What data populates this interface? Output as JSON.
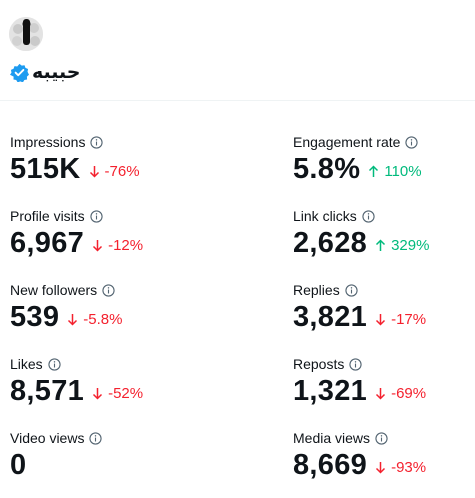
{
  "profile": {
    "name": "حبيبه",
    "verified": true,
    "accent_color": "#1d9bf0"
  },
  "colors": {
    "down": "#f4212e",
    "up": "#00ba7c"
  },
  "metrics": [
    {
      "label": "Impressions",
      "value": "515K",
      "change": "-76%",
      "direction": "down"
    },
    {
      "label": "Engagement rate",
      "value": "5.8%",
      "change": "110%",
      "direction": "up"
    },
    {
      "label": "Profile visits",
      "value": "6,967",
      "change": "-12%",
      "direction": "down"
    },
    {
      "label": "Link clicks",
      "value": "2,628",
      "change": "329%",
      "direction": "up"
    },
    {
      "label": "New followers",
      "value": "539",
      "change": "-5.8%",
      "direction": "down"
    },
    {
      "label": "Replies",
      "value": "3,821",
      "change": "-17%",
      "direction": "down"
    },
    {
      "label": "Likes",
      "value": "8,571",
      "change": "-52%",
      "direction": "down"
    },
    {
      "label": "Reposts",
      "value": "1,321",
      "change": "-69%",
      "direction": "down"
    },
    {
      "label": "Video views",
      "value": "0",
      "change": null,
      "direction": null
    },
    {
      "label": "Media views",
      "value": "8,669",
      "change": "-93%",
      "direction": "down"
    }
  ]
}
